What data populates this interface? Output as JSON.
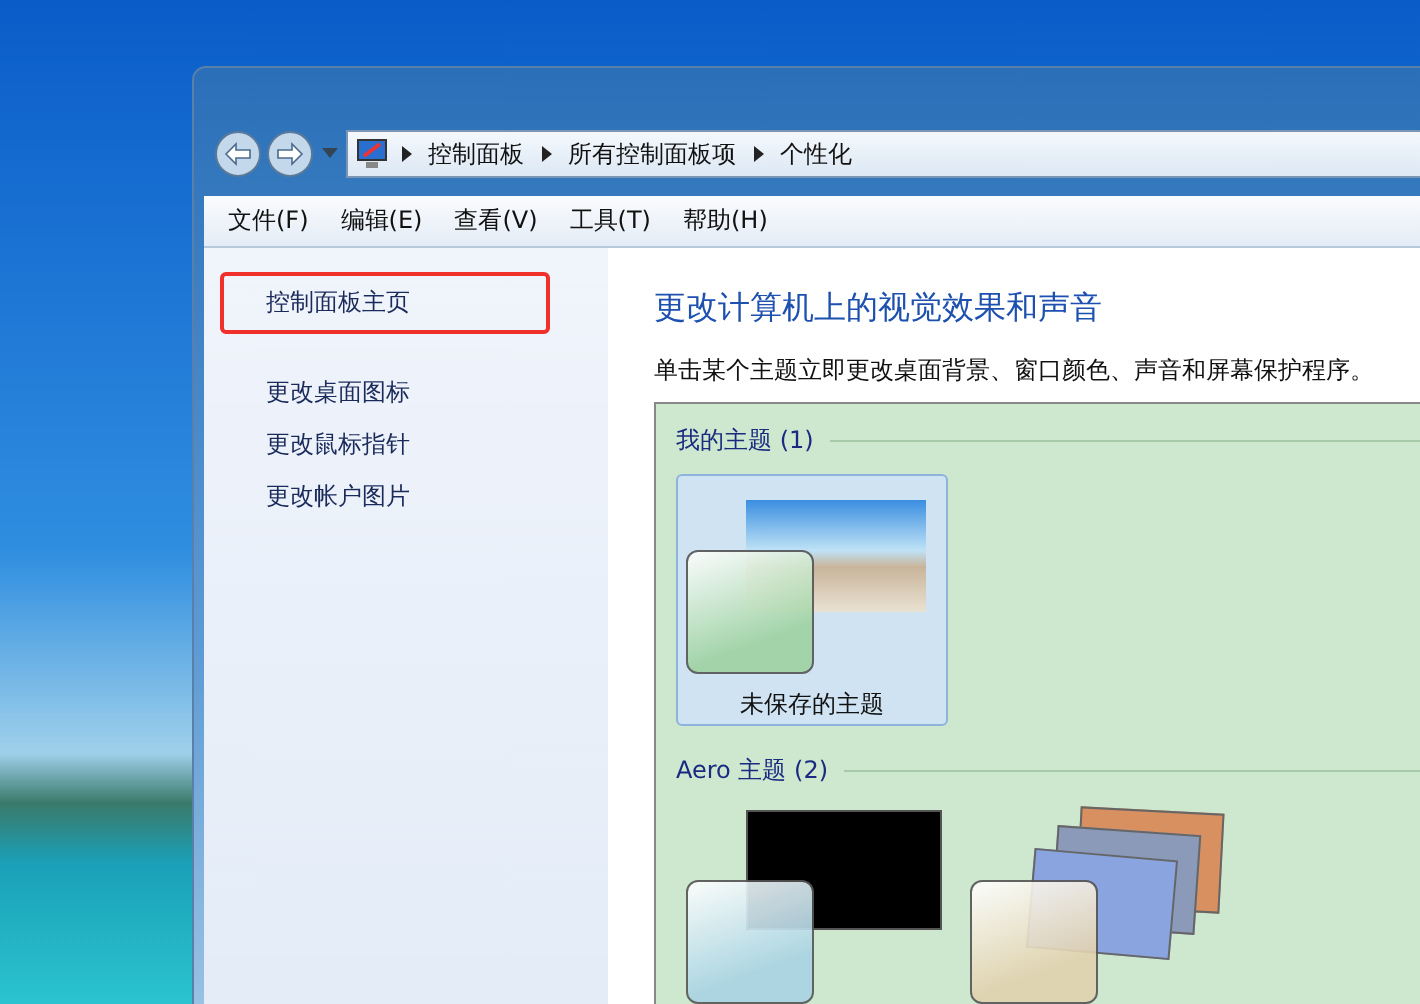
{
  "address_bar": {
    "breadcrumbs": [
      "控制面板",
      "所有控制面板项",
      "个性化"
    ]
  },
  "menu_bar": [
    "文件(F)",
    "编辑(E)",
    "查看(V)",
    "工具(T)",
    "帮助(H)"
  ],
  "sidebar": {
    "items": [
      {
        "label": "控制面板主页",
        "highlighted": true
      },
      {
        "label": "更改桌面图标",
        "highlighted": false
      },
      {
        "label": "更改鼠标指针",
        "highlighted": false
      },
      {
        "label": "更改帐户图片",
        "highlighted": false
      }
    ]
  },
  "content": {
    "title": "更改计算机上的视觉效果和声音",
    "description": "单击某个主题立即更改桌面背景、窗口颜色、声音和屏幕保护程序。",
    "groups": [
      {
        "title": "我的主题 (1)",
        "themes": [
          {
            "name": "未保存的主题",
            "selected": true,
            "kind": "photo",
            "color": "#9fd3a2"
          }
        ]
      },
      {
        "title": "Aero 主题 (2)",
        "themes": [
          {
            "selected": false,
            "kind": "black",
            "color": "#a9d4e4"
          },
          {
            "selected": false,
            "kind": "slideshow",
            "color": "#e2d2ae"
          }
        ]
      }
    ]
  }
}
